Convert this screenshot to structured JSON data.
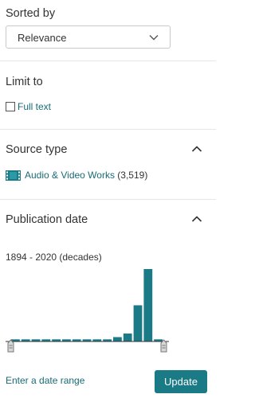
{
  "sort": {
    "heading": "Sorted by",
    "selected": "Relevance"
  },
  "limit": {
    "heading": "Limit to",
    "options": [
      {
        "label": "Full text",
        "checked": false
      }
    ]
  },
  "source_type": {
    "heading": "Source type",
    "items": [
      {
        "icon": "film-icon",
        "label": "Audio & Video Works",
        "count": "(3,519)"
      }
    ]
  },
  "publication_date": {
    "heading": "Publication date",
    "range_label": "1894 - 2020 (decades)",
    "date_range_link": "Enter a date range",
    "update_label": "Update",
    "histogram_color": "#1a7a85",
    "histogram_bin_heights_relative": [
      0.03,
      0.03,
      0.03,
      0.03,
      0.03,
      0.03,
      0.03,
      0.03,
      0.03,
      0.03,
      0.06,
      0.11,
      0.5,
      1.0,
      0.03
    ]
  },
  "colors": {
    "link": "#1a6b75",
    "accent": "#1a7a85",
    "divider": "#e6e6e6"
  }
}
